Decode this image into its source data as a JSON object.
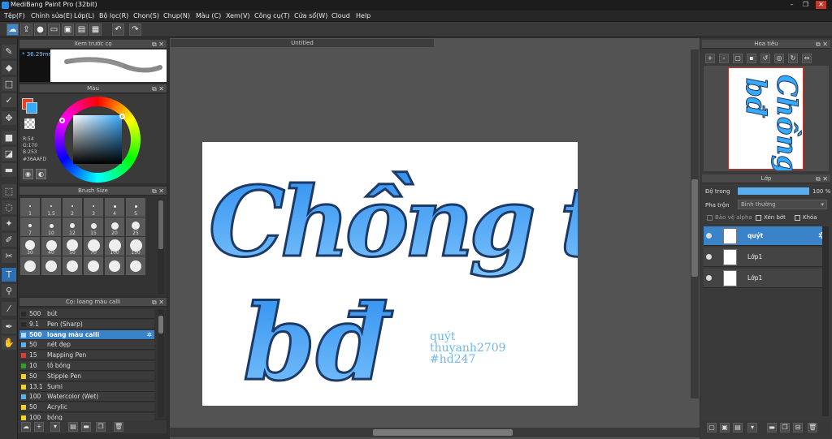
{
  "window": {
    "title": "MediBang Paint Pro (32bit)",
    "minimize": "–",
    "maximize": "❐",
    "close": "✕"
  },
  "menu": [
    "Tệp(F)",
    "Chỉnh sửa(E)",
    "Lớp(L)",
    "Bộ lọc(R)",
    "Chọn(S)",
    "Chụp(N)",
    "Màu (C)",
    "Xem(V)",
    "Công cụ(T)",
    "Cửa sổ(W)",
    "Cloud",
    "Help"
  ],
  "toolbar": {
    "icons": [
      "cloud-icon",
      "export-icon",
      "chat-icon",
      "comment-icon",
      "save-icon",
      "save-as-icon",
      "grid-icon",
      "undo-icon",
      "redo-icon"
    ]
  },
  "preview_panel": {
    "title": "Xem trước cọ",
    "size_label": "* 36.29mm"
  },
  "color_panel": {
    "title": "Màu",
    "r": "R:54",
    "g": "G:170",
    "b": "B:253",
    "hex": "#36AAFD",
    "accent": "#36AAFD"
  },
  "brush_size_panel": {
    "title": "Brush Size",
    "sizes": [
      "1",
      "1.5",
      "2",
      "3",
      "4",
      "5",
      "7",
      "10",
      "12",
      "15",
      "20",
      "25",
      "30",
      "40",
      "50",
      "70",
      "100",
      "150",
      "",
      "",
      "",
      "",
      "",
      ""
    ]
  },
  "brush_list": {
    "title": "Cọ: loang màu calli",
    "items": [
      {
        "size": "500",
        "name": "bút",
        "color": "#2a2a2a"
      },
      {
        "size": "9.1",
        "name": "Pen (Sharp)",
        "color": "#2a2a2a"
      },
      {
        "size": "500",
        "name": "loang màu calli",
        "color": "#b0d8ff",
        "selected": true
      },
      {
        "size": "50",
        "name": "nét đẹp",
        "color": "#57b4f0"
      },
      {
        "size": "15",
        "name": "Mapping Pen",
        "color": "#e23b3b"
      },
      {
        "size": "10",
        "name": "tô bóng",
        "color": "#2ea02e"
      },
      {
        "size": "50",
        "name": "Stipple Pen",
        "color": "#f2d22a"
      },
      {
        "size": "13.1",
        "name": "Sumi",
        "color": "#f2d22a"
      },
      {
        "size": "100",
        "name": "Watercolor (Wet)",
        "color": "#57b4f0"
      },
      {
        "size": "50",
        "name": "Acrylic",
        "color": "#f2d22a"
      },
      {
        "size": "100",
        "name": "bóng",
        "color": "#f2d22a"
      }
    ]
  },
  "document": {
    "tab": "Untitled"
  },
  "canvas_art": {
    "line1": "Chồng t",
    "line2": "bđ",
    "credit1": "quýt",
    "credit2": "thuyanh2709",
    "credit3": "#hd247"
  },
  "navigator": {
    "title": "Hoa tiêu"
  },
  "layers": {
    "title": "Lớp",
    "opacity_label": "Độ trong",
    "opacity_value": "100 %",
    "opacity_fraction": 1.0,
    "blend_label": "Pha trộn",
    "blend_value": "Bình thường",
    "protect_alpha": "Bảo vệ alpha",
    "clipping": "Xén bớt",
    "lock": "Khóa",
    "items": [
      {
        "name": "quýt",
        "selected": true
      },
      {
        "name": "Lớp1"
      },
      {
        "name": "Lớp1"
      }
    ]
  }
}
